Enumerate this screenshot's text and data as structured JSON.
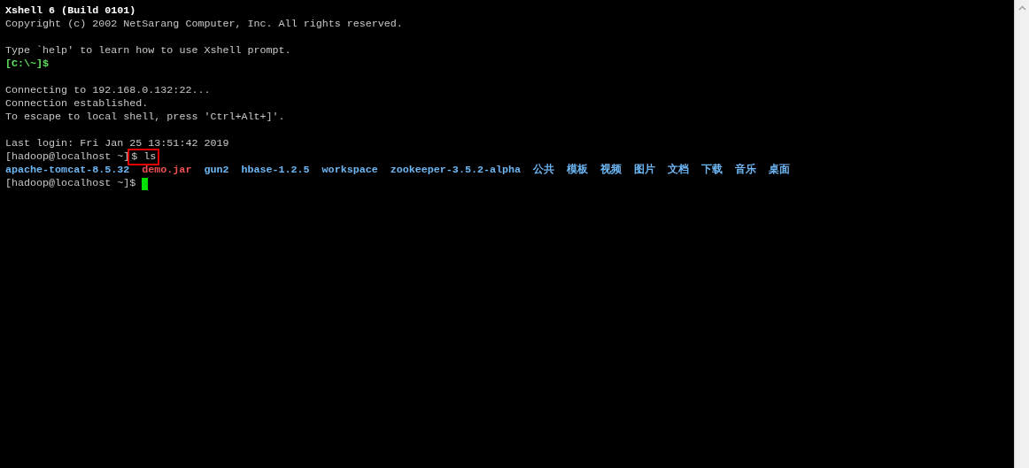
{
  "terminal": {
    "lines": [
      {
        "kind": "text",
        "segments": [
          {
            "kind": "bold",
            "text": "Xshell 6 (Build 0101)"
          }
        ]
      },
      {
        "kind": "text",
        "segments": [
          {
            "kind": "normal",
            "text": "Copyright (c) 2002 NetSarang Computer, Inc. All rights reserved."
          }
        ]
      },
      {
        "kind": "blank"
      },
      {
        "kind": "text",
        "segments": [
          {
            "kind": "normal",
            "text": "Type `help' to learn how to use Xshell prompt."
          }
        ]
      },
      {
        "kind": "text",
        "segments": [
          {
            "kind": "local-prompt",
            "text": "[C:\\~]$"
          }
        ]
      },
      {
        "kind": "blank"
      },
      {
        "kind": "text",
        "segments": [
          {
            "kind": "normal",
            "text": "Connecting to 192.168.0.132:22..."
          }
        ]
      },
      {
        "kind": "text",
        "segments": [
          {
            "kind": "normal",
            "text": "Connection established."
          }
        ]
      },
      {
        "kind": "text",
        "segments": [
          {
            "kind": "normal",
            "text": "To escape to local shell, press 'Ctrl+Alt+]'."
          }
        ]
      },
      {
        "kind": "blank"
      },
      {
        "kind": "text",
        "segments": [
          {
            "kind": "normal",
            "text": "Last login: Fri Jan 25 13:51:42 2019"
          }
        ]
      },
      {
        "kind": "text",
        "segments": [
          {
            "kind": "normal",
            "text": "[hadoop@localhost ~]"
          },
          {
            "kind": "boxed",
            "text": "$ ls"
          }
        ]
      },
      {
        "kind": "listing",
        "items": [
          {
            "kind": "directory",
            "text": "apache-tomcat-8.5.32"
          },
          {
            "kind": "archive",
            "text": "demo.jar"
          },
          {
            "kind": "directory",
            "text": "gun2"
          },
          {
            "kind": "directory",
            "text": "hbase-1.2.5"
          },
          {
            "kind": "directory",
            "text": "workspace"
          },
          {
            "kind": "directory",
            "text": "zookeeper-3.5.2-alpha"
          },
          {
            "kind": "directory",
            "text": "公共"
          },
          {
            "kind": "directory",
            "text": "模板"
          },
          {
            "kind": "directory",
            "text": "视频"
          },
          {
            "kind": "directory",
            "text": "图片"
          },
          {
            "kind": "directory",
            "text": "文档"
          },
          {
            "kind": "directory",
            "text": "下载"
          },
          {
            "kind": "directory",
            "text": "音乐"
          },
          {
            "kind": "directory",
            "text": "桌面"
          }
        ]
      },
      {
        "kind": "text",
        "cursor": true,
        "segments": [
          {
            "kind": "normal",
            "text": "[hadoop@localhost ~]$"
          }
        ]
      }
    ]
  }
}
